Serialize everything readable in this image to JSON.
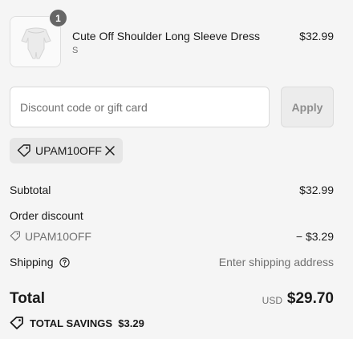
{
  "product": {
    "quantity": "1",
    "name": "Cute Off Shoulder Long Sleeve Dress",
    "variant": "S",
    "price": "$32.99",
    "image_description": "white off-shoulder romper"
  },
  "discount": {
    "placeholder": "Discount code or gift card",
    "value": "",
    "apply_label": "Apply",
    "applied_code": "UPAM10OFF"
  },
  "summary": {
    "subtotal_label": "Subtotal",
    "subtotal_value": "$32.99",
    "order_discount_label": "Order discount",
    "order_discount_code": "UPAM10OFF",
    "order_discount_value": "− $3.29",
    "shipping_label": "Shipping",
    "shipping_value": "Enter shipping address",
    "total_label": "Total",
    "total_currency": "USD",
    "total_value": "$29.70",
    "savings_label": "TOTAL SAVINGS",
    "savings_value": "$3.29"
  },
  "colors": {
    "background": "#f5f5f5",
    "text": "#1a1a1a",
    "muted": "#707070",
    "badge": "#666666",
    "chip": "#e6e6e6"
  },
  "icons": [
    "tag-icon",
    "close-icon",
    "help-circle-icon",
    "savings-tag-icon"
  ]
}
